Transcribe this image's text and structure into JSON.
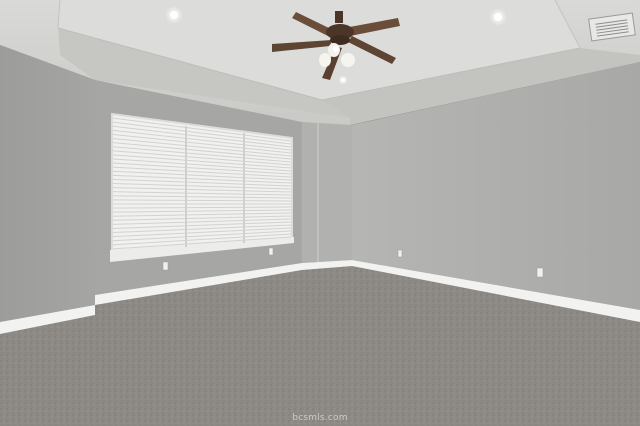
{
  "photo": {
    "subject": "empty-bedroom",
    "watermark": "bcsmls.com"
  }
}
